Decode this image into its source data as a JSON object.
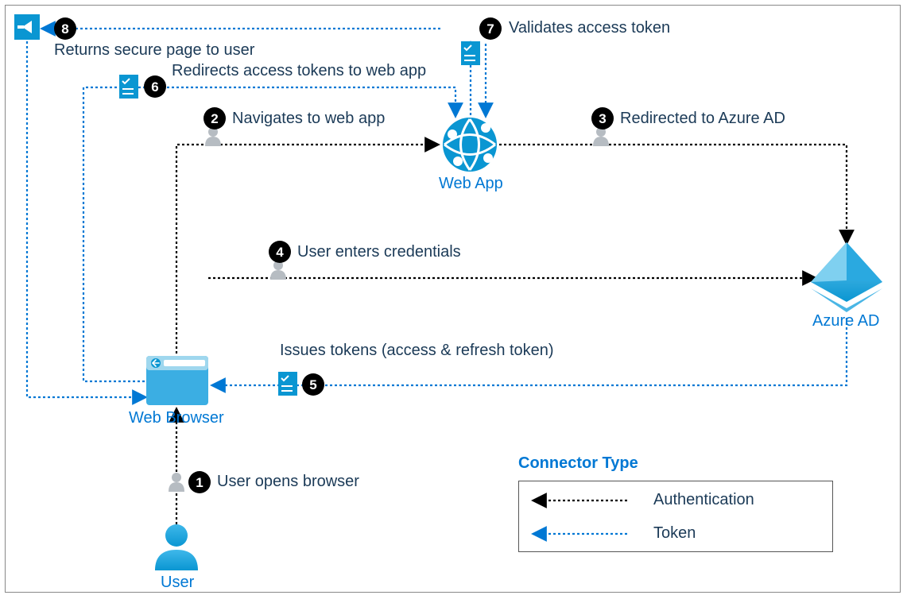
{
  "nodes": {
    "user": "User",
    "webBrowser": "Web Browser",
    "webApp": "Web App",
    "azureAD": "Azure AD"
  },
  "steps": {
    "s1": {
      "num": "1",
      "text": "User opens browser"
    },
    "s2": {
      "num": "2",
      "text": "Navigates to web app"
    },
    "s3": {
      "num": "3",
      "text": "Redirected to Azure AD"
    },
    "s4": {
      "num": "4",
      "text": "User enters credentials"
    },
    "s5": {
      "num": "5",
      "text": "Issues tokens (access & refresh token)"
    },
    "s6": {
      "num": "6",
      "text": "Redirects access tokens to web app"
    },
    "s7": {
      "num": "7",
      "text": "Validates access token"
    },
    "s8": {
      "num": "8",
      "text": "Returns secure page to user"
    }
  },
  "legend": {
    "title": "Connector Type",
    "authentication": "Authentication",
    "token": "Token"
  },
  "colors": {
    "azureBlue": "#0078d4",
    "darkText": "#1b3a57",
    "cyan": "#2aa9e0",
    "black": "#000000",
    "gray": "#9aa0a6"
  }
}
